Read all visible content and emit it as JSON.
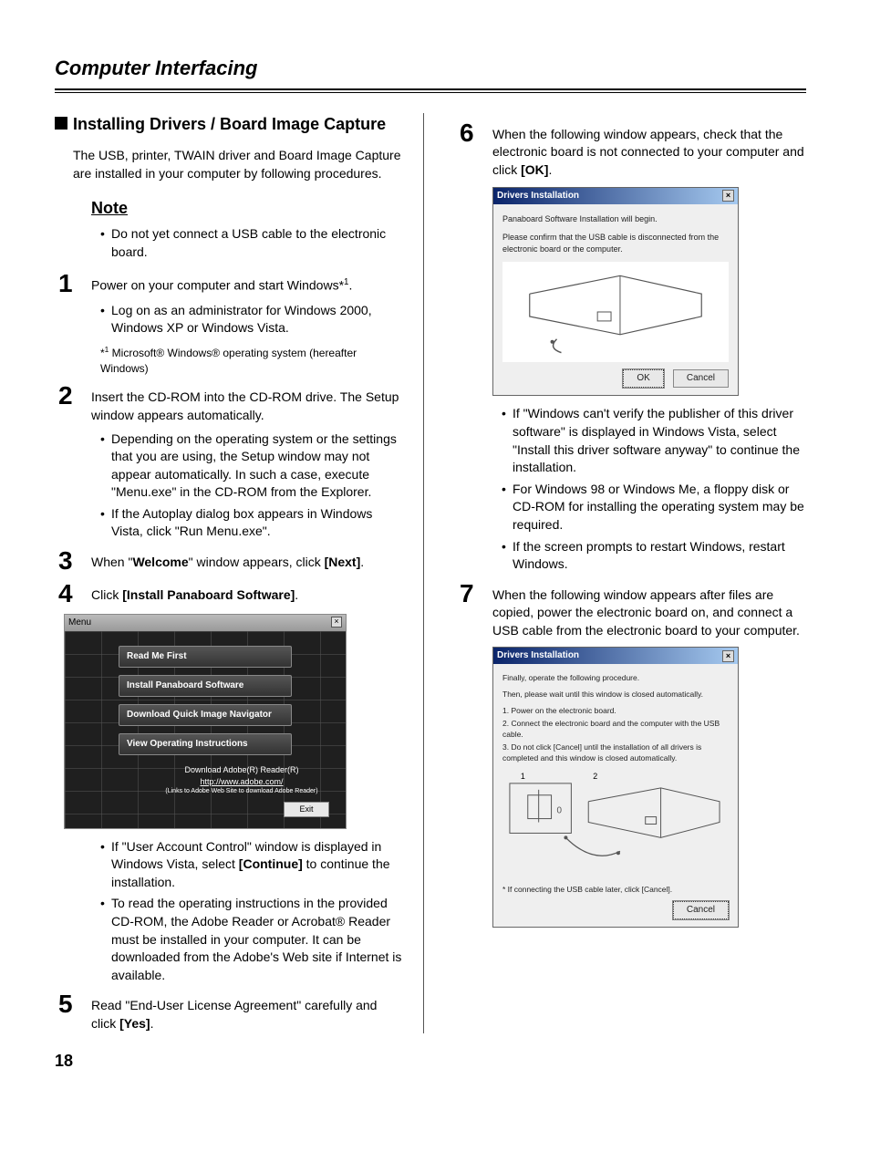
{
  "page_title": "Computer Interfacing",
  "subsection_title": "Installing Drivers / Board Image Capture",
  "intro": "The USB, printer, TWAIN driver and Board Image Capture are installed in your computer by following procedures.",
  "note_heading": "Note",
  "note_bullets": [
    "Do not yet connect a USB cable to the electronic board."
  ],
  "steps": {
    "1": {
      "text_pre": "Power on your computer and start Windows*",
      "sup": "1",
      "text_post": ".",
      "bullets": [
        "Log on as an administrator for Windows 2000, Windows XP or Windows Vista."
      ],
      "footnote_pre": "*",
      "footnote_sup": "1",
      "footnote_body": " Microsoft® Windows® operating system (hereafter Windows)"
    },
    "2": {
      "text": "Insert the CD-ROM into the CD-ROM drive. The Setup window appears automatically.",
      "bullets": [
        "Depending on the operating system or the settings that you are using, the Setup window may not appear automatically. In such a case, execute \"Menu.exe\" in the CD-ROM from the Explorer.",
        "If the Autoplay dialog box appears in Windows Vista, click \"Run Menu.exe\"."
      ]
    },
    "3": {
      "pre": "When \"",
      "bold1": "Welcome",
      "mid": "\" window appears, click ",
      "bold2": "[Next]",
      "post": "."
    },
    "4": {
      "pre": "Click ",
      "bold": "[Install Panaboard Software]",
      "post": ".",
      "bullets": [
        "If \"User Account Control\" window is displayed in Windows Vista, select [Continue] to continue the installation.",
        "To read the operating instructions in the provided CD-ROM, the Adobe Reader or Acrobat® Reader must be installed in your computer. It can be downloaded from the Adobe's Web site if Internet is available."
      ]
    },
    "5": {
      "pre": "Read \"End-User License Agreement\" carefully and click ",
      "bold": "[Yes]",
      "post": "."
    },
    "6": {
      "pre": "When the following window appears, check that the electronic board is not connected to your computer and click ",
      "bold": "[OK]",
      "post": ".",
      "bullets": [
        "If \"Windows can't verify the publisher of this driver software\" is displayed in Windows Vista, select \"Install this driver software anyway\" to continue the installation.",
        "For Windows 98 or Windows Me, a floppy disk or CD-ROM for installing the operating system may be required.",
        "If the screen prompts to restart Windows, restart Windows."
      ]
    },
    "7": {
      "text": "When the following window appears after files are copied, power the electronic board on, and connect a USB cable from the electronic board to your computer."
    }
  },
  "menu_window": {
    "title": "Menu",
    "buttons": [
      "Read Me First",
      "Install Panaboard Software",
      "Download Quick Image Navigator",
      "View Operating Instructions"
    ],
    "adobe_head": "Download Adobe(R) Reader(R)",
    "adobe_link": "http://www.adobe.com/",
    "adobe_fine": "(Links to Adobe Web Site to download Adobe Reader)",
    "exit": "Exit"
  },
  "dialog1": {
    "title": "Drivers Installation",
    "line1": "Panaboard Software Installation will begin.",
    "line2": "Please confirm that the USB cable is disconnected from the electronic board or the computer.",
    "ok": "OK",
    "cancel": "Cancel"
  },
  "dialog2": {
    "title": "Drivers Installation",
    "instr1": "Finally, operate the following procedure.",
    "instr2": "Then, please wait until this window is closed automatically.",
    "items": [
      "1. Power on the electronic board.",
      "2. Connect the electronic board and the computer with the USB cable.",
      "3. Do not click [Cancel] until the installation of all drivers is completed and this window is closed automatically."
    ],
    "diagram_labels": {
      "one": "1",
      "two": "2"
    },
    "footfine": "* If connecting the USB cable later, click [Cancel].",
    "cancel": "Cancel"
  },
  "page_number": "18",
  "bullet_bold": {
    "s4b0": "[Continue]"
  }
}
